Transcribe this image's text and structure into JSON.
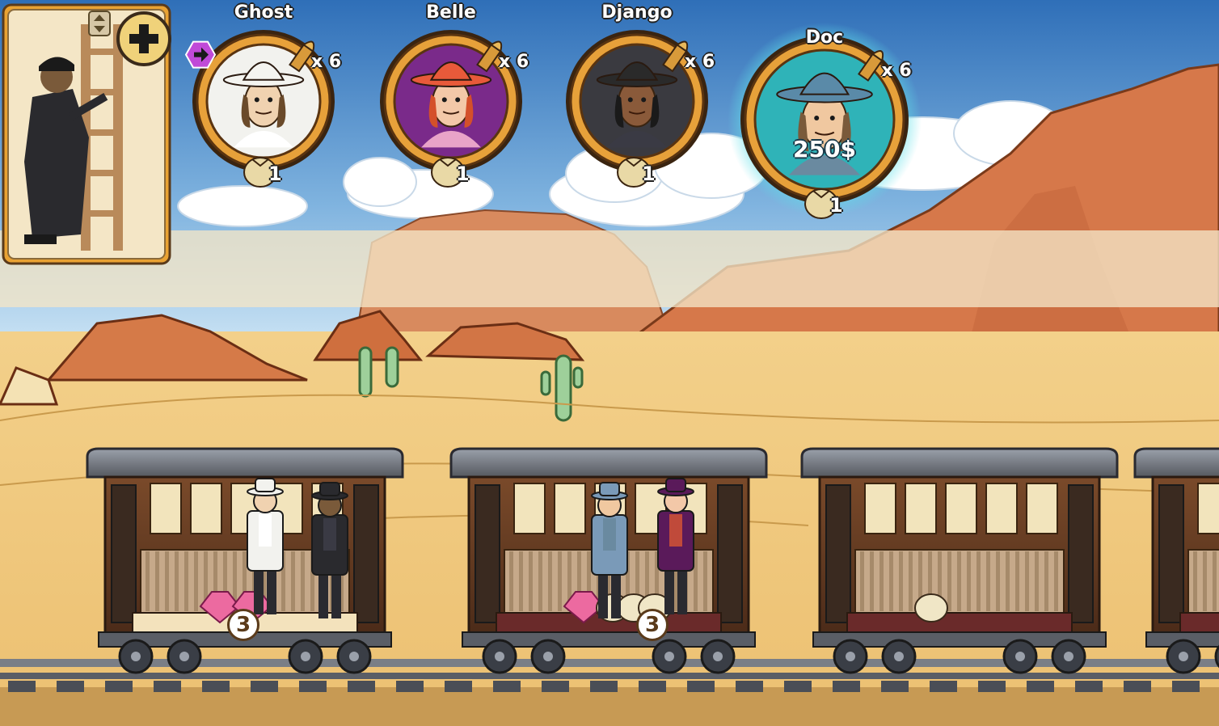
{
  "players": [
    {
      "name": "Ghost",
      "ammo": "x 6",
      "loot": "1",
      "frame": "#f2f2ee",
      "skin": "#f0d2b0",
      "hat": "#f4f4f0",
      "hair": "#6a4a2a",
      "outfit": "#ffffff",
      "first_player": true
    },
    {
      "name": "Belle",
      "ammo": "x 6",
      "loot": "1",
      "frame": "#7a2a8a",
      "skin": "#f3c8a8",
      "hat": "#e85a3a",
      "hair": "#d4502a",
      "outfit": "#e9a3c8",
      "first_player": false
    },
    {
      "name": "Django",
      "ammo": "x 6",
      "loot": "1",
      "frame": "#3a3a40",
      "skin": "#8a5a3a",
      "hat": "#2a2a2a",
      "hair": "#1a1a1a",
      "outfit": "#3a3a44",
      "first_player": false
    },
    {
      "name": "Doc",
      "ammo": "x 6",
      "loot": "1",
      "frame": "#2fb3b8",
      "skin": "#f0c8a0",
      "hat": "#5a8aa8",
      "hair": "#7a5a3a",
      "outfit": "#6a8aa0",
      "first_player": false,
      "money": "250$",
      "active": true
    }
  ],
  "action_card": {
    "icon": "climb-icon",
    "add_icon": "plus-icon"
  },
  "wagons": [
    {
      "badge": "3",
      "loot": [
        "gem",
        "gem"
      ]
    },
    {
      "badge": "3",
      "loot": [
        "gem",
        "bag",
        "bag",
        "bag"
      ]
    },
    {
      "badge": "",
      "loot": [
        "bag"
      ]
    },
    {
      "badge": "",
      "loot": []
    }
  ],
  "colors": {
    "sky_top": "#3d7fc4",
    "sky_bottom": "#a9d1ef",
    "sand": "#f0c877",
    "rock": "#d67a4a",
    "accent_gold": "#e7a13a"
  }
}
